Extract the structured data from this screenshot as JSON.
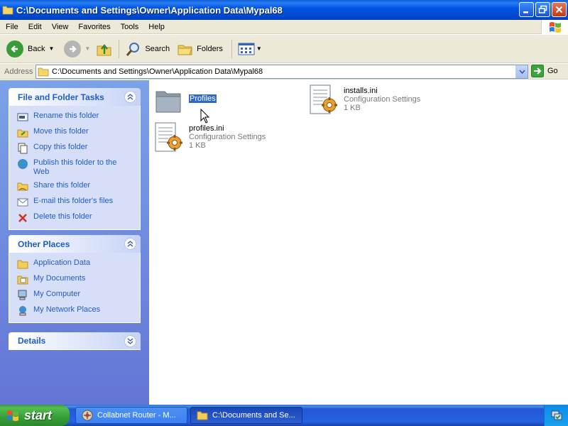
{
  "window": {
    "title": "C:\\Documents and Settings\\Owner\\Application Data\\Mypal68"
  },
  "menu": [
    "File",
    "Edit",
    "View",
    "Favorites",
    "Tools",
    "Help"
  ],
  "toolbar": {
    "back_label": "Back",
    "search_label": "Search",
    "folders_label": "Folders"
  },
  "address": {
    "label": "Address",
    "value": "C:\\Documents and Settings\\Owner\\Application Data\\Mypal68",
    "go_label": "Go"
  },
  "left_pane": {
    "file_tasks": {
      "title": "File and Folder Tasks",
      "items": [
        {
          "label": "Rename this folder",
          "icon": "rename-icon"
        },
        {
          "label": "Move this folder",
          "icon": "move-icon"
        },
        {
          "label": "Copy this folder",
          "icon": "copy-icon"
        },
        {
          "label": "Publish this folder to the Web",
          "icon": "globe-icon"
        },
        {
          "label": "Share this folder",
          "icon": "share-icon"
        },
        {
          "label": "E-mail this folder's files",
          "icon": "email-icon"
        },
        {
          "label": "Delete this folder",
          "icon": "delete-icon"
        }
      ]
    },
    "other_places": {
      "title": "Other Places",
      "items": [
        {
          "label": "Application Data",
          "icon": "folder-icon"
        },
        {
          "label": "My Documents",
          "icon": "documents-icon"
        },
        {
          "label": "My Computer",
          "icon": "computer-icon"
        },
        {
          "label": "My Network Places",
          "icon": "network-icon"
        }
      ]
    },
    "details": {
      "title": "Details"
    }
  },
  "files": [
    {
      "name": "Profiles",
      "type": "folder",
      "selected": true
    },
    {
      "name": "installs.ini",
      "type": "Configuration Settings",
      "size": "1 KB"
    },
    {
      "name": "profiles.ini",
      "type": "Configuration Settings",
      "size": "1 KB"
    }
  ],
  "taskbar": {
    "start_label": "start",
    "buttons": [
      {
        "label": "Collabnet Router - M...",
        "active": false
      },
      {
        "label": "C:\\Documents and Se...",
        "active": true
      }
    ]
  }
}
